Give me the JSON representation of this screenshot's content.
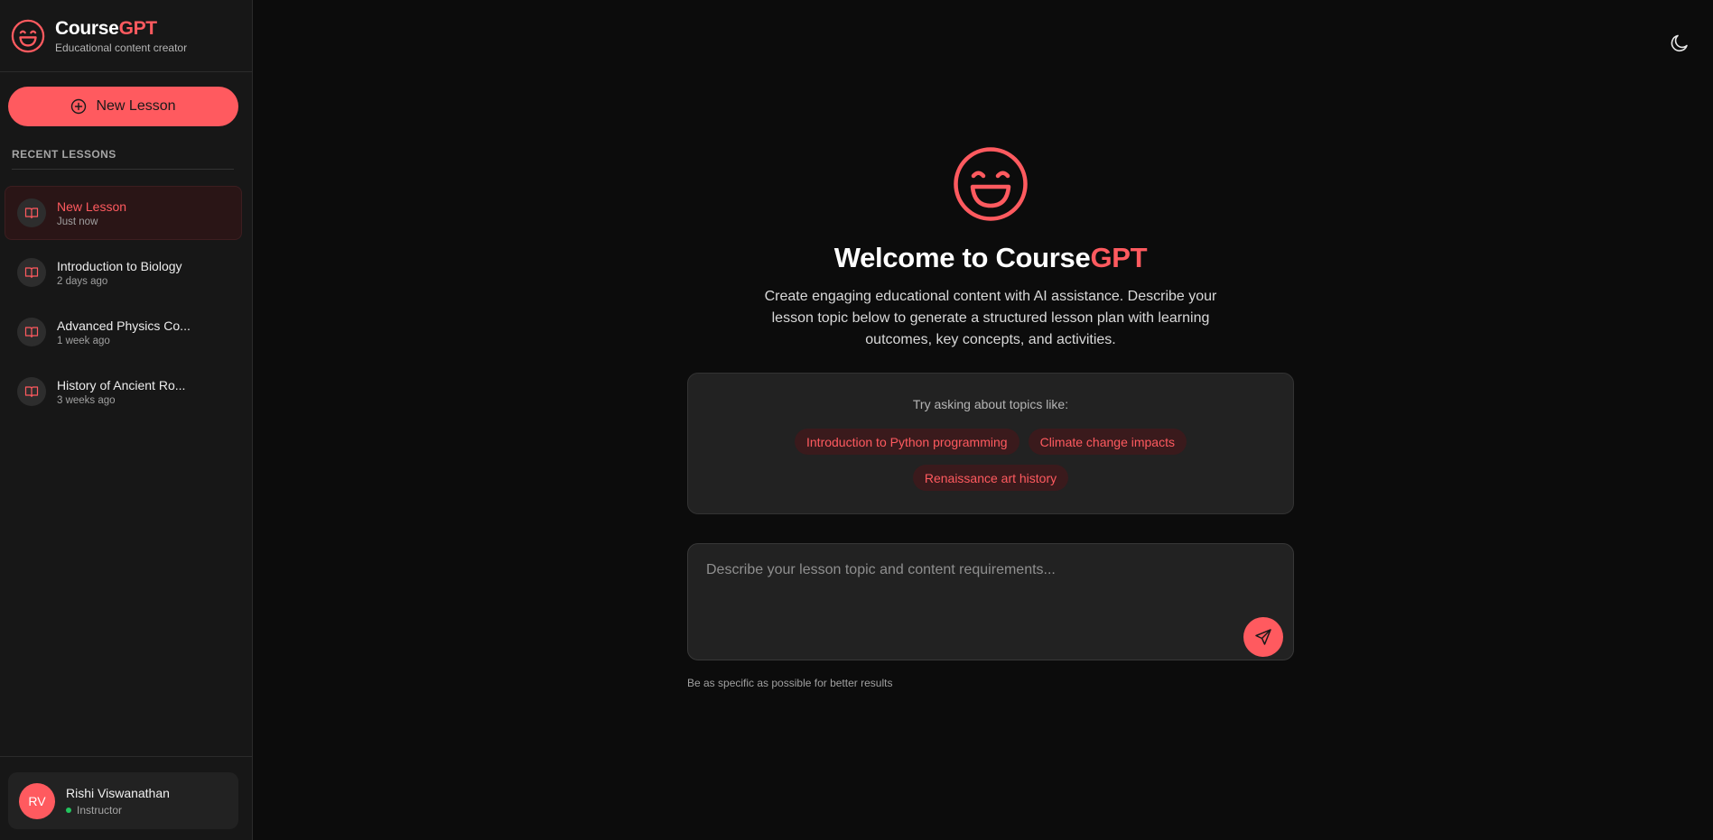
{
  "brand": {
    "name_main": "Course",
    "name_accent": "GPT",
    "subtitle": "Educational content creator"
  },
  "sidebar": {
    "new_lesson_label": "New Lesson",
    "recent_title": "RECENT LESSONS",
    "lessons": [
      {
        "name": "New Lesson",
        "time": "Just now",
        "active": true
      },
      {
        "name": "Introduction to Biology",
        "time": "2 days ago",
        "active": false
      },
      {
        "name": "Advanced Physics Co...",
        "time": "1 week ago",
        "active": false
      },
      {
        "name": "History of Ancient Ro...",
        "time": "3 weeks ago",
        "active": false
      }
    ]
  },
  "user": {
    "initials": "RV",
    "name": "Rishi Viswanathan",
    "role": "Instructor"
  },
  "main": {
    "welcome_prefix": "Welcome to Course",
    "welcome_accent": "GPT",
    "intro": "Create engaging educational content with AI assistance. Describe your lesson topic below to generate a structured lesson plan with learning outcomes, key concepts, and activities.",
    "suggest_title": "Try asking about topics like:",
    "suggestions": [
      "Introduction to Python programming",
      "Climate change impacts",
      "Renaissance art history"
    ],
    "input_placeholder": "Describe your lesson topic and content requirements...",
    "hint": "Be as specific as possible for better results"
  },
  "icons": {
    "logo": "smiley-logo-icon",
    "new": "plus-circle-icon",
    "lesson": "book-open-icon",
    "theme": "moon-icon",
    "send": "send-icon"
  },
  "colors": {
    "accent": "#ff5a5f",
    "background": "#0c0c0c",
    "sidebar": "#171717",
    "online": "#22c55e"
  }
}
